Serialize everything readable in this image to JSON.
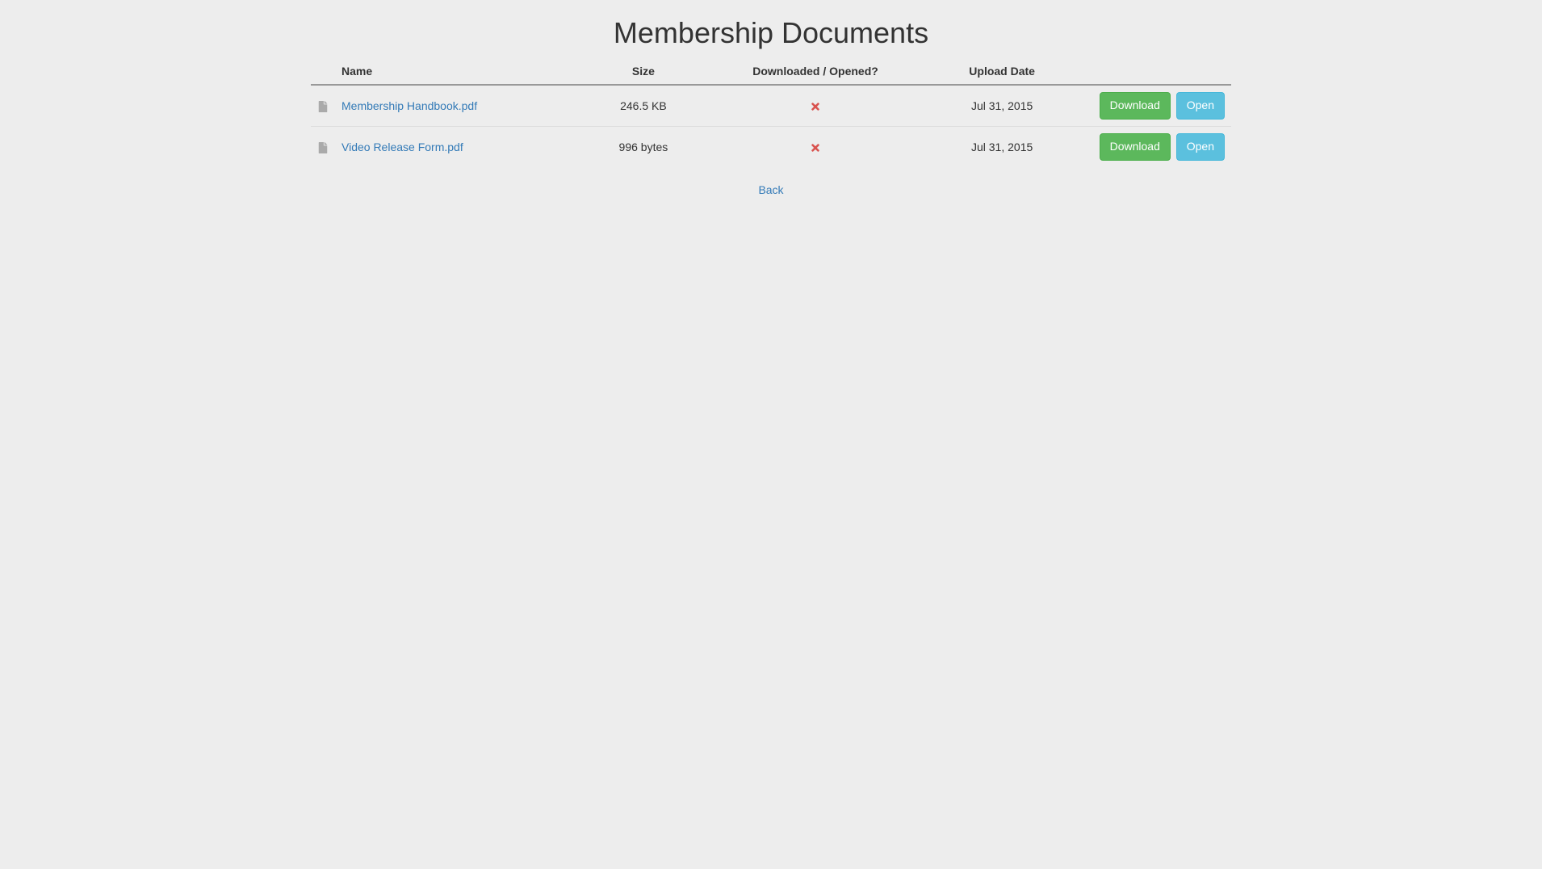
{
  "page": {
    "title": "Membership Documents",
    "back_label": "Back"
  },
  "table": {
    "headers": {
      "name": "Name",
      "size": "Size",
      "downloaded": "Downloaded / Opened?",
      "upload_date": "Upload Date"
    },
    "actions": {
      "download_label": "Download",
      "open_label": "Open"
    },
    "rows": [
      {
        "name": "Membership Handbook.pdf",
        "size": "246.5 KB",
        "downloaded": false,
        "upload_date": "Jul 31, 2015"
      },
      {
        "name": "Video Release Form.pdf",
        "size": "996 bytes",
        "downloaded": false,
        "upload_date": "Jul 31, 2015"
      }
    ]
  }
}
